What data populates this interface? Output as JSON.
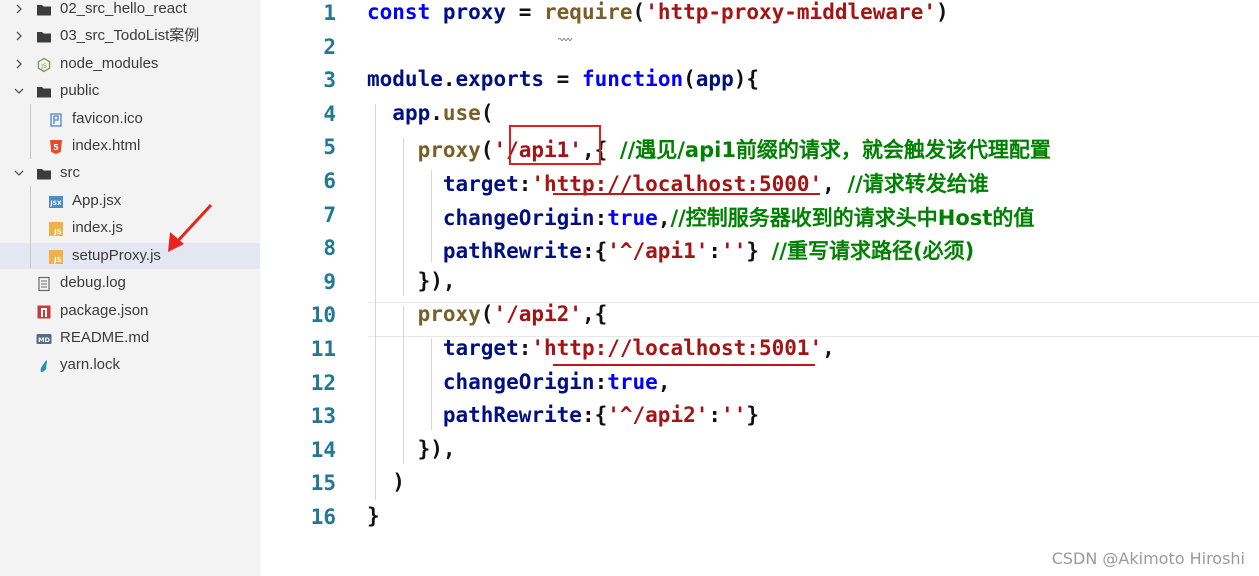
{
  "explorer": {
    "items": [
      {
        "label": "02_src_hello_react",
        "kind": "folder",
        "state": "collapsed",
        "icon": "folder-icon"
      },
      {
        "label": "03_src_TodoList案例",
        "kind": "folder",
        "state": "collapsed",
        "icon": "folder-icon"
      },
      {
        "label": "node_modules",
        "kind": "folder",
        "state": "collapsed",
        "icon": "node-modules-icon"
      },
      {
        "label": "public",
        "kind": "folder",
        "state": "expanded",
        "icon": "folder-icon"
      },
      {
        "label": "favicon.ico",
        "kind": "file",
        "icon": "ico-file-icon"
      },
      {
        "label": "index.html",
        "kind": "file",
        "icon": "html5-icon"
      },
      {
        "label": "src",
        "kind": "folder",
        "state": "expanded",
        "icon": "folder-icon"
      },
      {
        "label": "App.jsx",
        "kind": "file",
        "icon": "jsx-file-icon"
      },
      {
        "label": "index.js",
        "kind": "file",
        "icon": "js-file-icon"
      },
      {
        "label": "setupProxy.js",
        "kind": "file",
        "icon": "js-file-icon",
        "selected": true
      },
      {
        "label": "debug.log",
        "kind": "file",
        "icon": "log-file-icon"
      },
      {
        "label": "package.json",
        "kind": "file",
        "icon": "npm-icon"
      },
      {
        "label": "README.md",
        "kind": "file",
        "icon": "markdown-icon"
      },
      {
        "label": "yarn.lock",
        "kind": "file",
        "icon": "yarn-icon"
      }
    ]
  },
  "editor": {
    "lines": [
      {
        "n": "1",
        "tokens": [
          [
            "kw",
            "const "
          ],
          [
            "blue",
            "proxy "
          ],
          [
            "br",
            "= "
          ],
          [
            "fn",
            "require"
          ],
          [
            "br",
            "("
          ],
          [
            "str",
            "'http-proxy-middleware'"
          ],
          [
            "br",
            ")"
          ]
        ]
      },
      {
        "n": "2",
        "tokens": []
      },
      {
        "n": "3",
        "tokens": [
          [
            "blue",
            "module"
          ],
          [
            "br",
            "."
          ],
          [
            "blue",
            "exports "
          ],
          [
            "br",
            "= "
          ],
          [
            "kw",
            "function"
          ],
          [
            "br",
            "("
          ],
          [
            "blue",
            "app"
          ],
          [
            "br",
            "){"
          ]
        ]
      },
      {
        "n": "4",
        "tokens": [
          [
            "br",
            "  "
          ],
          [
            "blue",
            "app"
          ],
          [
            "br",
            "."
          ],
          [
            "fn",
            "use"
          ],
          [
            "br",
            "("
          ]
        ]
      },
      {
        "n": "5",
        "tokens": [
          [
            "br",
            "    "
          ],
          [
            "fn",
            "proxy"
          ],
          [
            "br",
            "("
          ],
          [
            "str",
            "'/api1'"
          ],
          [
            "br",
            ",{ "
          ],
          [
            "cmt",
            "//遇见/api1前缀的请求，就会触发该代理配置"
          ]
        ]
      },
      {
        "n": "6",
        "tokens": [
          [
            "br",
            "      "
          ],
          [
            "blue",
            "target"
          ],
          [
            "br",
            ":"
          ],
          [
            "str",
            "'http://localhost:5000'"
          ],
          [
            "br",
            ", "
          ],
          [
            "cmt",
            "//请求转发给谁"
          ]
        ]
      },
      {
        "n": "7",
        "tokens": [
          [
            "br",
            "      "
          ],
          [
            "blue",
            "changeOrigin"
          ],
          [
            "br",
            ":"
          ],
          [
            "kw",
            "true"
          ],
          [
            "br",
            ","
          ],
          [
            "cmt",
            "//控制服务器收到的请求头中Host的值"
          ]
        ]
      },
      {
        "n": "8",
        "tokens": [
          [
            "br",
            "      "
          ],
          [
            "blue",
            "pathRewrite"
          ],
          [
            "br",
            ":{"
          ],
          [
            "str",
            "'^/api1'"
          ],
          [
            "br",
            ":"
          ],
          [
            "str",
            "''"
          ],
          [
            "br",
            "} "
          ],
          [
            "cmt",
            "//重写请求路径(必须)"
          ]
        ]
      },
      {
        "n": "9",
        "tokens": [
          [
            "br",
            "    }),"
          ]
        ]
      },
      {
        "n": "10",
        "tokens": [
          [
            "br",
            "    "
          ],
          [
            "fn",
            "proxy"
          ],
          [
            "br",
            "("
          ],
          [
            "str",
            "'/api2'"
          ],
          [
            "br",
            ",{"
          ]
        ],
        "current": true
      },
      {
        "n": "11",
        "tokens": [
          [
            "br",
            "      "
          ],
          [
            "blue",
            "target"
          ],
          [
            "br",
            ":"
          ],
          [
            "str",
            "'http://localhost:5001'"
          ],
          [
            "br",
            ","
          ]
        ]
      },
      {
        "n": "12",
        "tokens": [
          [
            "br",
            "      "
          ],
          [
            "blue",
            "changeOrigin"
          ],
          [
            "br",
            ":"
          ],
          [
            "kw",
            "true"
          ],
          [
            "br",
            ","
          ]
        ]
      },
      {
        "n": "13",
        "tokens": [
          [
            "br",
            "      "
          ],
          [
            "blue",
            "pathRewrite"
          ],
          [
            "br",
            ":{"
          ],
          [
            "str",
            "'^/api2'"
          ],
          [
            "br",
            ":"
          ],
          [
            "str",
            "''"
          ],
          [
            "br",
            "}"
          ]
        ]
      },
      {
        "n": "14",
        "tokens": [
          [
            "br",
            "    }),"
          ]
        ]
      },
      {
        "n": "15",
        "tokens": [
          [
            "br",
            "  )"
          ]
        ]
      },
      {
        "n": "16",
        "tokens": [
          [
            "br",
            "}"
          ]
        ]
      }
    ]
  },
  "annotations": {
    "highlight_box_text": "'/api1'",
    "arrow_target": "setupProxy.js",
    "arrow_color": "#e8241c",
    "box_color": "#e02020"
  },
  "watermark": "CSDN @Akimoto Hiroshi",
  "colors": {
    "keyword": "#0000ff",
    "function": "#795e26",
    "string": "#a31515",
    "comment": "#008000",
    "identifier": "#001080",
    "line_number": "#237893",
    "sidebar_bg": "#f3f3f3",
    "selected_bg": "#e4e6f1"
  }
}
